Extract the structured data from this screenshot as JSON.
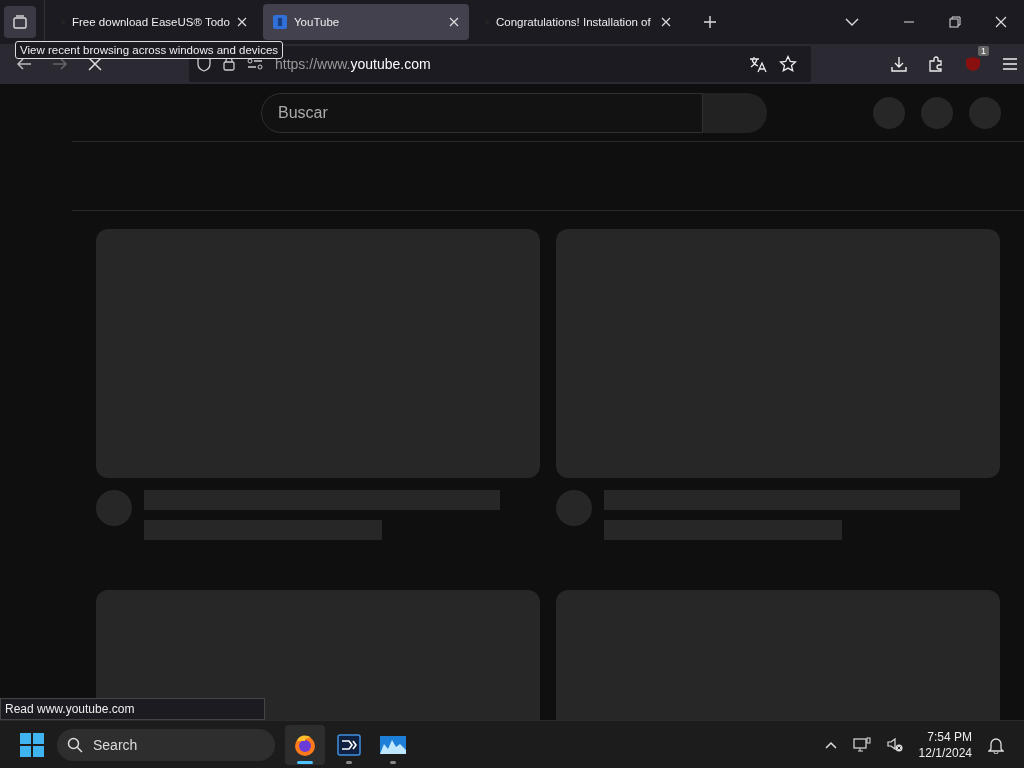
{
  "browser": {
    "tabs": [
      {
        "title": "Free download EaseUS® Todo",
        "selected": false
      },
      {
        "title": "YouTube",
        "selected": true
      },
      {
        "title": "Congratulations! Installation of",
        "selected": false
      }
    ],
    "tooltip": "View recent browsing across windows and devices",
    "url": {
      "prefix": "https://www.",
      "domain": "youtube.com"
    },
    "extension_badge": "1",
    "status": "Read www.youtube.com"
  },
  "page": {
    "search": {
      "placeholder": "Buscar"
    },
    "feed": [
      {
        "kind": "skeleton"
      },
      {
        "kind": "skeleton"
      },
      {
        "kind": "thumbnail"
      },
      {
        "kind": "thumbnail"
      }
    ]
  },
  "taskbar": {
    "search": {
      "placeholder": "Search"
    },
    "apps": [
      {
        "kind": "firefox",
        "selected": true
      },
      {
        "kind": "remote",
        "selected": false
      },
      {
        "kind": "monitor",
        "selected": false
      }
    ],
    "time": "7:54 PM",
    "date": "12/1/2024"
  }
}
